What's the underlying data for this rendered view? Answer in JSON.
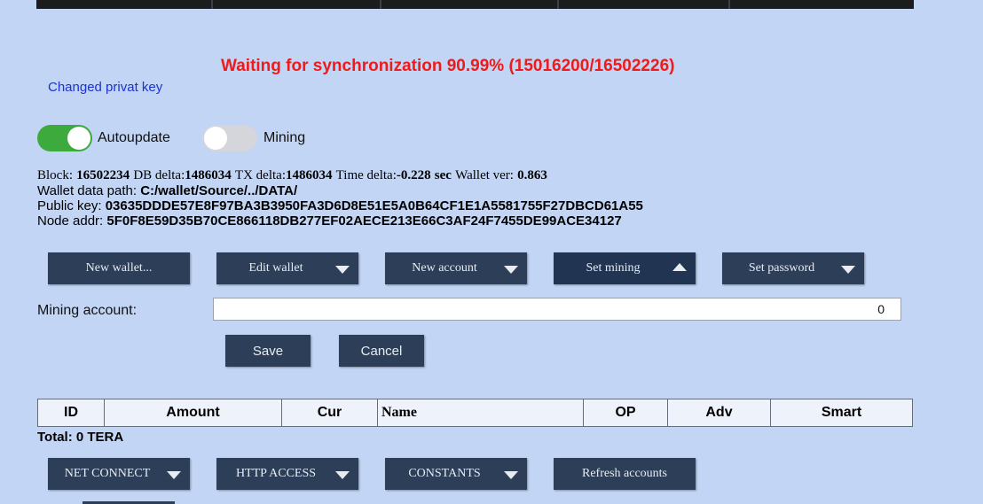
{
  "top_bar": {},
  "changed_key_link": "Changed privat key",
  "sync_status": "Waiting for synchronization 90.99% (15016200/16502226)",
  "toggles": {
    "autoupdate": {
      "label": "Autoupdate",
      "on": true
    },
    "mining": {
      "label": "Mining",
      "on": false
    }
  },
  "status": {
    "block_label": "Block:",
    "block_value": "16502234",
    "db_delta_label": "DB delta:",
    "db_delta_value": "1486034",
    "tx_delta_label": "TX delta:",
    "tx_delta_value": "1486034",
    "time_delta_label": "Time delta:",
    "time_delta_value": "-0.228",
    "time_delta_unit": "sec",
    "wallet_ver_label": "Wallet ver:",
    "wallet_ver_value": "0.863",
    "wallet_path_label": "Wallet data path:",
    "wallet_path_value": "C:/wallet/Source/../DATA/",
    "public_key_label": "Public key:",
    "public_key_value": "03635DDDE57E8F97BA3B3950FA3D6D8E51E5A0B64CF1E1A5581755F27DBCD61A55",
    "node_addr_label": "Node addr:",
    "node_addr_value": "5F0F8E59D35B70CE866118DB277EF02AECE213E66C3AF24F7455DE99ACE34127"
  },
  "toolbar": {
    "new_wallet": "New wallet...",
    "edit_wallet": "Edit wallet",
    "new_account": "New account",
    "set_mining": "Set mining",
    "set_password": "Set password"
  },
  "mining_account": {
    "label": "Mining account:",
    "value": "0"
  },
  "form_buttons": {
    "save": "Save",
    "cancel": "Cancel"
  },
  "accounts_table": {
    "headers": [
      "ID",
      "Amount",
      "Cur",
      "Name",
      "OP",
      "Adv",
      "Smart"
    ],
    "total": "Total: 0 TERA"
  },
  "bottom_toolbar": {
    "net_connect": "NET CONNECT",
    "http_access": "HTTP ACCESS",
    "constants": "CONSTANTS",
    "refresh_accounts": "Refresh accounts"
  },
  "colors": {
    "background": "#c2d5f4",
    "button": "#2c3e58",
    "sync_text": "#ef1a1a",
    "link": "#1a33d1",
    "toggle_on": "#3caa3c"
  }
}
